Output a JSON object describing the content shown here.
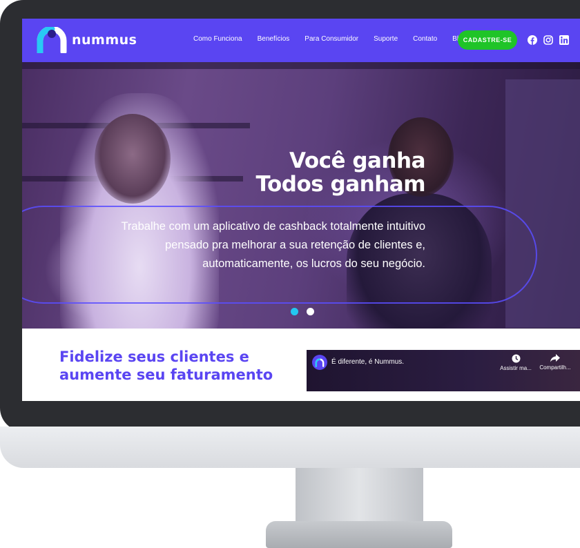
{
  "brand": {
    "name": "nummus",
    "primary_color": "#5a45f2",
    "cta_color": "#1fc428",
    "accent_color": "#23c7f0"
  },
  "nav": {
    "items": [
      {
        "label": "Como Funciona"
      },
      {
        "label": "Benefícios"
      },
      {
        "label": "Para Consumidor"
      },
      {
        "label": "Suporte"
      },
      {
        "label": "Contato"
      },
      {
        "label": "Blog"
      }
    ],
    "cta_label": "CADASTRE-SE",
    "social": [
      "facebook-icon",
      "instagram-icon",
      "linkedin-icon"
    ]
  },
  "hero": {
    "title_line1": "Você ganha",
    "title_line2": "Todos ganham",
    "subtitle": "Trabalhe com um aplicativo de cashback totalmente intuitivo pensado pra melhorar a sua retenção de clientes e, automaticamente, os lucros do seu negócio.",
    "slides": 2,
    "active_slide": 1
  },
  "features": {
    "heading_line1": "Fidelize seus clientes e",
    "heading_line2": "aumente seu faturamento"
  },
  "video": {
    "title": "É diferente, é Nummus.",
    "watch_later_label": "Assistir ma...",
    "share_label": "Compartilh..."
  }
}
